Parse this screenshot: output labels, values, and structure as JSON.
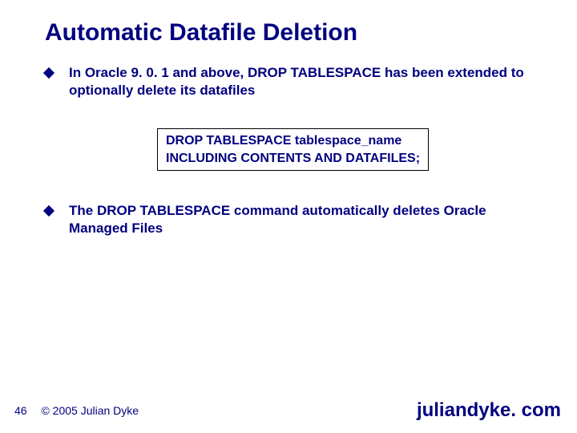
{
  "title": "Automatic Datafile Deletion",
  "bullets": [
    {
      "pre": "In Oracle 9. 0. 1 and above, ",
      "strong": "DROP TABLESPACE",
      "post": " has been extended to optionally delete its datafiles"
    },
    {
      "pre": "The ",
      "strong": "DROP TABLESPACE ",
      "post": "command automatically deletes Oracle Managed Files"
    }
  ],
  "code": {
    "line1": "DROP TABLESPACE tablespace_name",
    "line2": "INCLUDING CONTENTS AND DATAFILES;"
  },
  "footer": {
    "page": "46",
    "copyright": "© 2005 Julian Dyke",
    "site": "juliandyke. com"
  }
}
